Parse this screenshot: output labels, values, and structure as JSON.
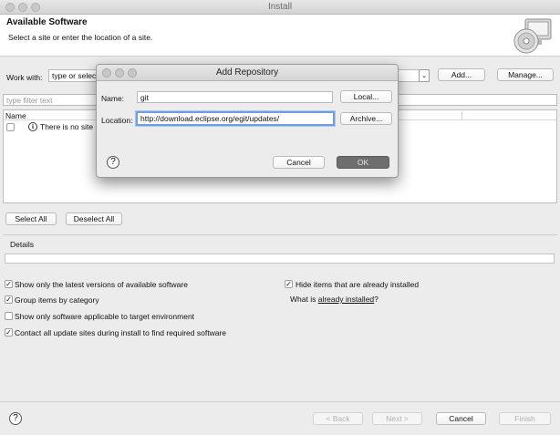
{
  "window": {
    "title": "Install"
  },
  "header": {
    "title": "Available Software",
    "subtitle": "Select a site or enter the location of a site."
  },
  "work_with": {
    "label": "Work with:",
    "value": "type or select a site",
    "add_label": "Add...",
    "manage_label": "Manage..."
  },
  "filter": {
    "placeholder": "type filter text"
  },
  "tree": {
    "column_name": "Name",
    "message": "There is no site selected."
  },
  "selection": {
    "select_all": "Select All",
    "deselect_all": "Deselect All"
  },
  "details": {
    "label": "Details"
  },
  "options": {
    "latest_versions": "Show only the latest versions of available software",
    "group_by_category": "Group items by category",
    "target_env": "Show only software applicable to target environment",
    "contact_sites": "Contact all update sites during install to find required software",
    "hide_installed": "Hide items that are already installed",
    "what_is": "What is",
    "already_installed": "already installed",
    "question_mark": "?"
  },
  "footer": {
    "back": "< Back",
    "next": "Next >",
    "cancel": "Cancel",
    "finish": "Finish"
  },
  "dialog": {
    "title": "Add Repository",
    "name_label": "Name:",
    "name_value": "git",
    "location_label": "Location:",
    "location_value": "http://download.eclipse.org/egit/updates/",
    "local_button": "Local...",
    "archive_button": "Archive...",
    "cancel_button": "Cancel",
    "ok_button": "OK"
  }
}
